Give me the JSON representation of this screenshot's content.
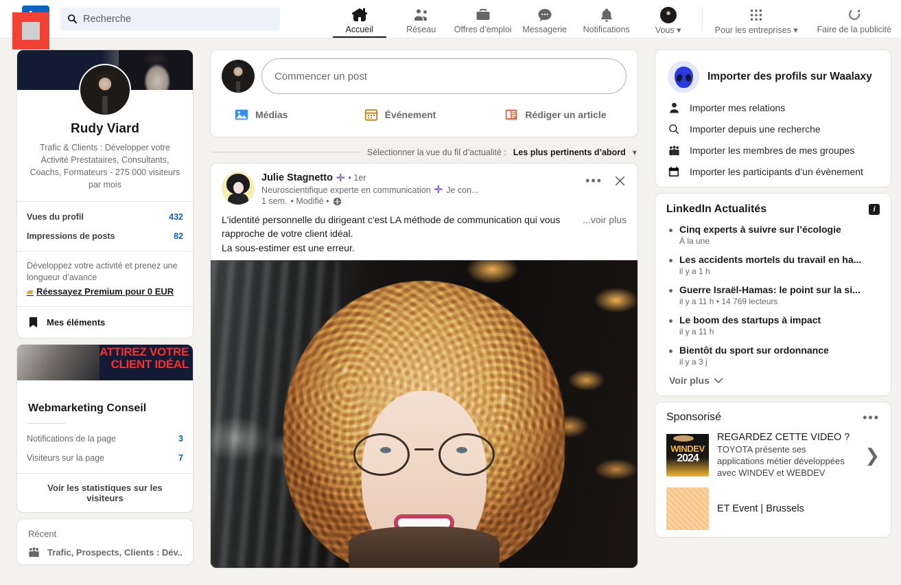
{
  "nav": {
    "logo": "in",
    "search_placeholder": "Recherche",
    "items": [
      {
        "label": "Accueil",
        "icon": "home-icon",
        "active": true
      },
      {
        "label": "Réseau",
        "icon": "network-icon",
        "active": false
      },
      {
        "label": "Offres d’emploi",
        "icon": "briefcase-icon",
        "active": false
      },
      {
        "label": "Messagerie",
        "icon": "message-icon",
        "active": false
      },
      {
        "label": "Notifications",
        "icon": "bell-icon",
        "active": false
      },
      {
        "label": "Vous",
        "icon": "avatar-icon",
        "active": false
      }
    ],
    "business_label": "Pour les entreprises",
    "advertise_label": "Faire de la publicité"
  },
  "profile": {
    "name": "Rudy Viard",
    "headline": "Trafic & Clients : Développer votre Activité Prestataires, Consultants, Coachs, Formateurs - 275 000 visiteurs par mois",
    "stats": [
      {
        "label": "Vues du profil",
        "value": "432"
      },
      {
        "label": "Impressions de posts",
        "value": "82"
      }
    ],
    "premium_text": "Développez votre activité et prenez une longueur d’avance",
    "premium_link": "Réessayez Premium pour 0 EUR",
    "my_items": "Mes éléments"
  },
  "company": {
    "banner_slogan_line1": "ATTIREZ VOTRE",
    "banner_slogan_line2": "CLIENT IDÉAL",
    "name": "Webmarketing Conseil",
    "stats": [
      {
        "label": "Notifications de la page",
        "value": "3"
      },
      {
        "label": "Visiteurs sur la page",
        "value": "7"
      }
    ],
    "see_stats": "Voir les statistiques sur les visiteurs"
  },
  "recent": {
    "title": "Récent",
    "items": [
      {
        "label": "Trafic, Prospects, Clients : Dév...",
        "icon": "group-icon"
      }
    ]
  },
  "composer": {
    "placeholder": "Commencer un post",
    "actions": [
      {
        "label": "Médias",
        "icon": "media-icon",
        "color": "#378fe9"
      },
      {
        "label": "Événement",
        "icon": "calendar-icon",
        "color": "#c37d16"
      },
      {
        "label": "Rédiger un article",
        "icon": "article-icon",
        "color": "#e16745"
      }
    ]
  },
  "sortbar": {
    "prefix": "Sélectionner la vue du fil d’actualité :",
    "value": "Les plus pertinents d’abord"
  },
  "post": {
    "author": "Julie Stagnetto",
    "degree": "• 1er",
    "headline": "Neuroscientifique experte en communication",
    "follow_label": "Je con...",
    "time": "1 sem.",
    "edited": "• Modifié •",
    "visibility_icon": "globe-icon",
    "text_line1": "L'identité personnelle du dirigeant c'est LA méthode de communication qui vous rapproche de votre client idéal.",
    "text_line2": "La sous-estimer est une erreur.",
    "see_more": "...voir plus",
    "menu_icon": "ellipsis-icon",
    "close_icon": "close-icon"
  },
  "waalaxy": {
    "title": "Importer des profils sur Waalaxy",
    "icon": "alien-icon",
    "items": [
      {
        "label": "Importer mes relations",
        "icon": "person-icon"
      },
      {
        "label": "Importer depuis une recherche",
        "icon": "search-icon"
      },
      {
        "label": "Importer les membres de mes groupes",
        "icon": "group-icon"
      },
      {
        "label": "Importer les participants d’un évènement",
        "icon": "calendar-icon"
      }
    ]
  },
  "news": {
    "title": "LinkedIn Actualités",
    "info_icon": "info-icon",
    "items": [
      {
        "headline": "Cinq experts à suivre sur l’écologie",
        "sub": "À la une"
      },
      {
        "headline": "Les accidents mortels du travail en ha...",
        "sub": "il y a 1 h"
      },
      {
        "headline": "Guerre Israël-Hamas: le point sur la si...",
        "sub": "il y a 11 h • 14 769 lecteurs"
      },
      {
        "headline": "Le boom des startups à impact",
        "sub": "il y a 11 h"
      },
      {
        "headline": "Bientôt du sport sur ordonnance",
        "sub": "il y a 3 j"
      }
    ],
    "see_more": "Voir plus"
  },
  "sponsored": {
    "title": "Sponsorisé",
    "menu_icon": "ellipsis-icon",
    "ads": [
      {
        "thumb": "windev-2024-logo",
        "thumb_line1": "WINDEV",
        "thumb_line2": "2024",
        "headline": "REGARDEZ CETTE VIDEO ?",
        "body": "TOYOTA présente ses applications métier développées avec WINDEV et WEBDEV"
      },
      {
        "thumb": "orange-pattern",
        "headline": "ET Event | Brussels",
        "body": ""
      }
    ]
  },
  "colors": {
    "brand": "#0a66c2",
    "page_bg": "#f4f2ee",
    "card_bg": "#ffffff"
  }
}
